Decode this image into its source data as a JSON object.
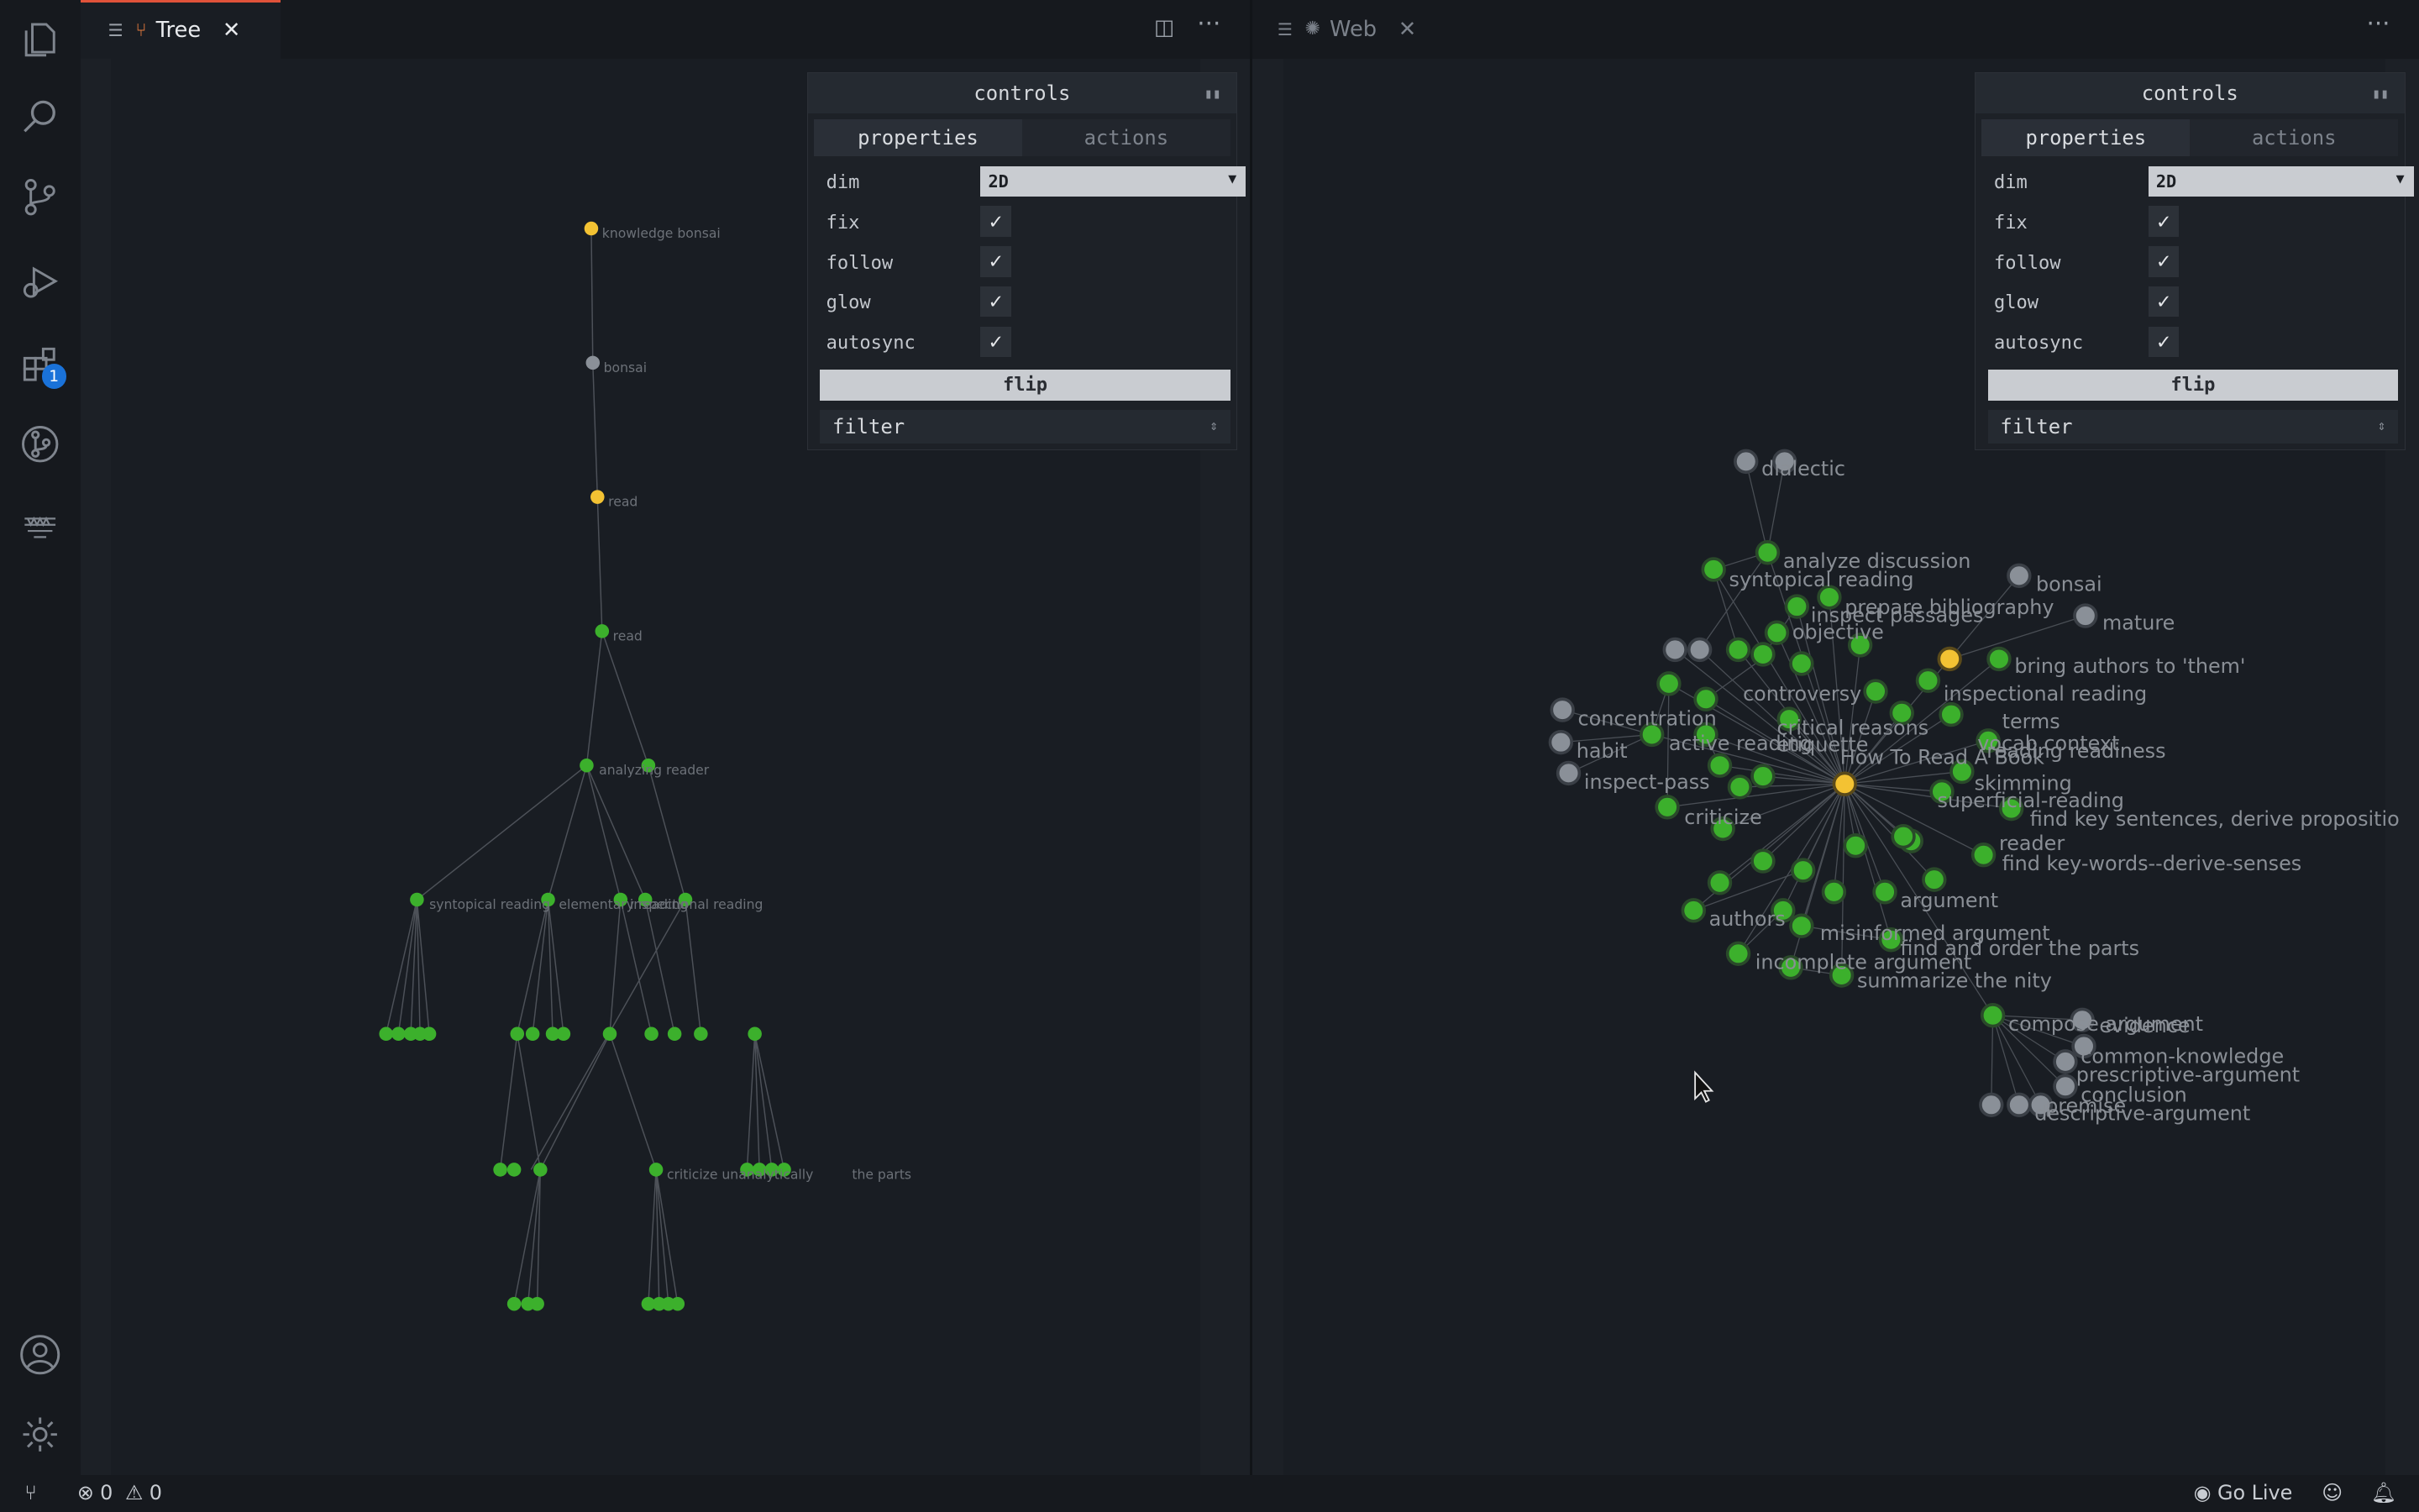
{
  "left_pane": {
    "tab_label": "Tree"
  },
  "right_pane": {
    "tab_label": "Web"
  },
  "activity_bar": {
    "extensions_badge": "1"
  },
  "controls": {
    "title": "controls",
    "tab_properties": "properties",
    "tab_actions": "actions",
    "dim_label": "dim",
    "dim_value": "2D",
    "fix_label": "fix",
    "follow_label": "follow",
    "glow_label": "glow",
    "autosync_label": "autosync",
    "flip_label": "flip",
    "filter_label": "filter"
  },
  "tree_graph": {
    "node_labels": [
      "knowledge bonsai",
      "bonsai",
      "read",
      "read",
      "analyzing reader",
      "syntopical reading",
      "elementary reading",
      "inspectional reading",
      "criticize unanalytically",
      "the parts"
    ]
  },
  "web_graph": {
    "node_labels": [
      "dialectic",
      "analyze discussion",
      "syntopical reading",
      "prepare bibliography",
      "inspect passages",
      "objective",
      "bonsai",
      "mature",
      "bring authors to 'them'",
      "inspectional reading",
      "concentration",
      "habit",
      "inspect-pass",
      "active reading",
      "etiquette",
      "How To Read A Book",
      "reading readiness",
      "skimming",
      "superficial-reading",
      "find key sentences, derive propositio",
      "reader",
      "find key-words--derive-senses",
      "criticize",
      "authors",
      "misinformed argument",
      "find and order the parts",
      "incomplete argument",
      "summarize the nity",
      "compose argument",
      "evidence",
      "common-knowledge",
      "prescriptive-argument",
      "conclusion",
      "premise",
      "descriptive-argument",
      "controversy",
      "critical reasons",
      "vocab context",
      "terms",
      "argument"
    ]
  },
  "status": {
    "errors": "0",
    "warnings": "0",
    "go_live": "Go Live"
  },
  "colors": {
    "node_green": "#3cb02c",
    "node_yellow": "#f3c233",
    "node_grey": "#8a9098",
    "accent_tab": "#e0523a"
  }
}
